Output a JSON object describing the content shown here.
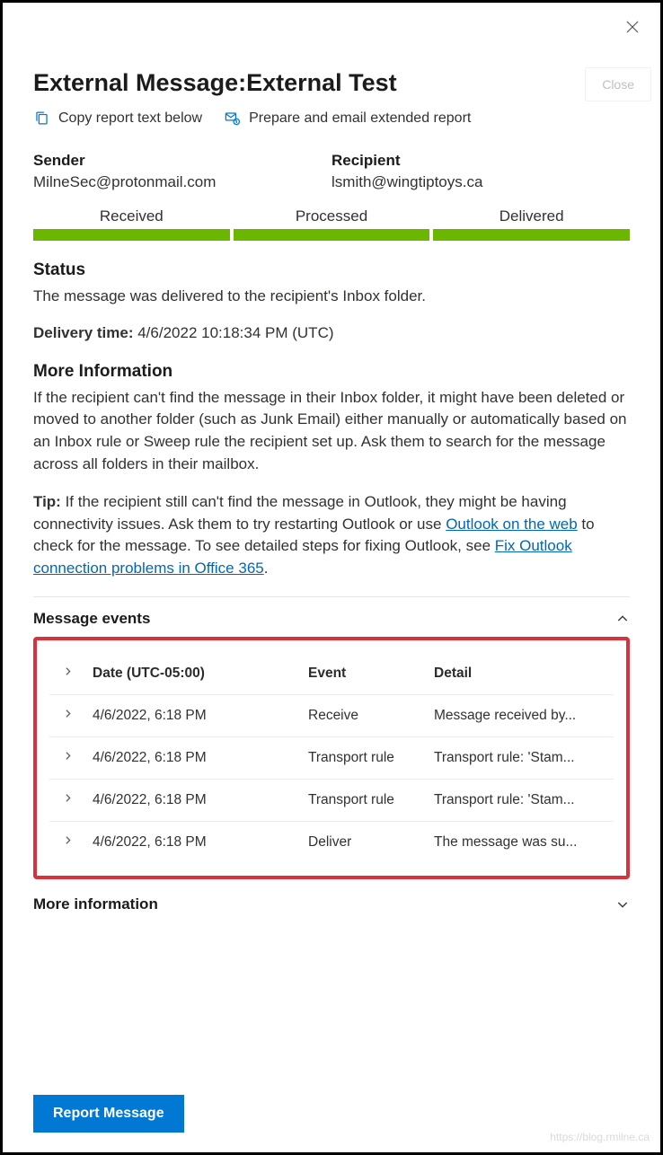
{
  "title": "External Message:External Test",
  "close_ghost_label": "Close",
  "actions": {
    "copy_label": "Copy report text below",
    "email_label": "Prepare and email extended report"
  },
  "fields": {
    "sender_label": "Sender",
    "sender_value": "MilneSec@protonmail.com",
    "recipient_label": "Recipient",
    "recipient_value": "lsmith@wingtiptoys.ca"
  },
  "stages": {
    "received": "Received",
    "processed": "Processed",
    "delivered": "Delivered"
  },
  "status": {
    "heading": "Status",
    "text": "The message was delivered to the recipient's Inbox folder."
  },
  "delivery": {
    "label": "Delivery time:",
    "value": " 4/6/2022 10:18:34 PM (UTC)"
  },
  "moreinfo": {
    "heading": "More Information",
    "para1": "If the recipient can't find the message in their Inbox folder, it might have been deleted or moved to another folder (such as Junk Email) either manually or automatically based on an Inbox rule or Sweep rule the recipient set up. Ask them to search for the message across all folders in their mailbox.",
    "tip_label": "Tip:",
    "tip_before": " If the recipient still can't find the message in Outlook, they might be having connectivity issues. Ask them to try restarting Outlook or use ",
    "tip_link1": "Outlook on the web",
    "tip_mid": " to check for the message. To see detailed steps for fixing Outlook, see ",
    "tip_link2": "Fix Outlook connection problems in Office 365",
    "tip_after": "."
  },
  "events": {
    "heading": "Message events",
    "columns": {
      "date": "Date (UTC-05:00)",
      "event": "Event",
      "detail": "Detail"
    },
    "rows": [
      {
        "date": "4/6/2022, 6:18 PM",
        "event": "Receive",
        "detail": "Message received by..."
      },
      {
        "date": "4/6/2022, 6:18 PM",
        "event": "Transport rule",
        "detail": "Transport rule: 'Stam..."
      },
      {
        "date": "4/6/2022, 6:18 PM",
        "event": "Transport rule",
        "detail": "Transport rule: 'Stam..."
      },
      {
        "date": "4/6/2022, 6:18 PM",
        "event": "Deliver",
        "detail": "The message was su..."
      }
    ]
  },
  "moreinfo2_heading": "More information",
  "report_button": "Report Message",
  "watermark": "https://blog.rmilne.ca"
}
